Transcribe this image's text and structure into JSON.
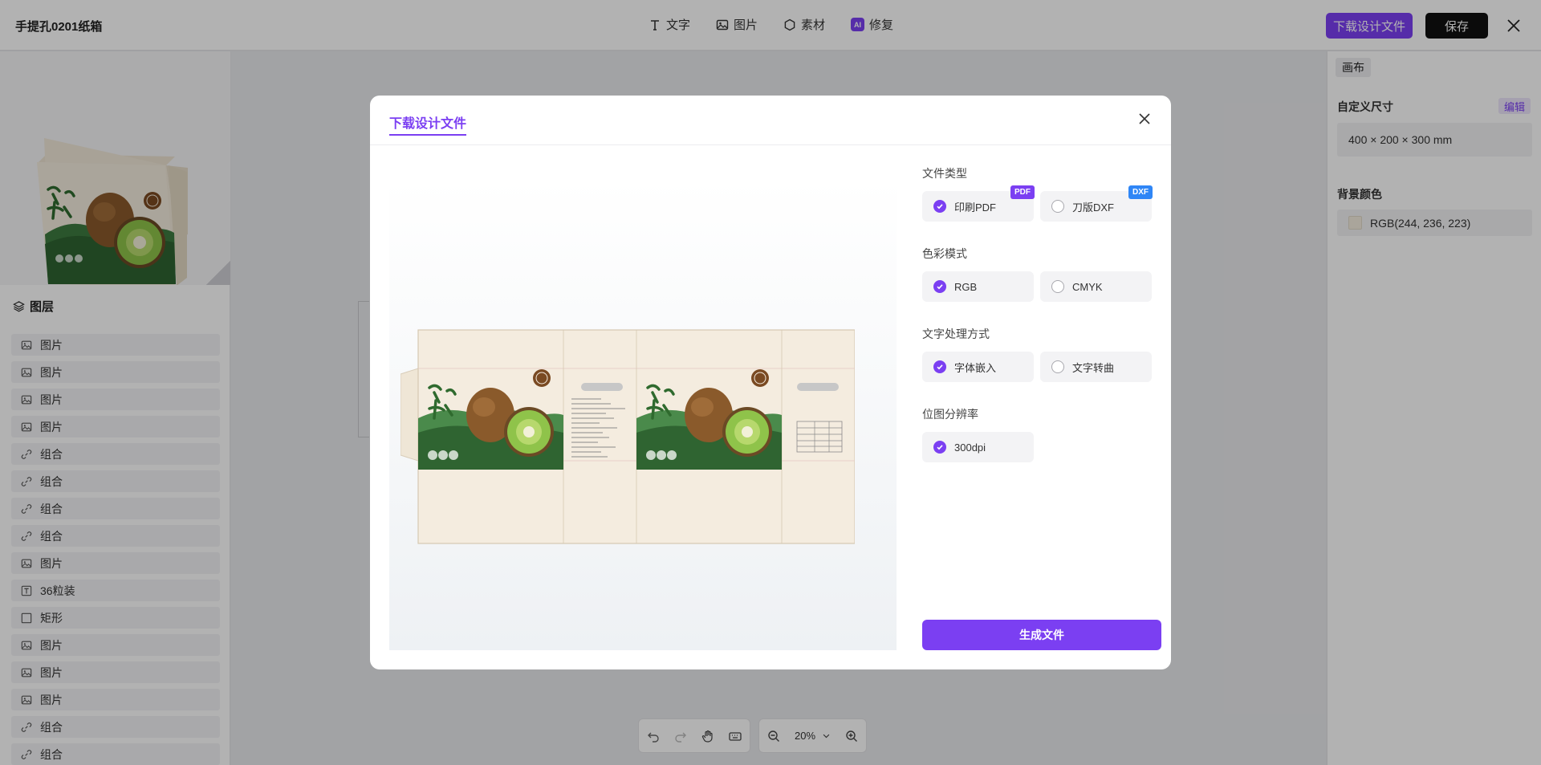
{
  "app": {
    "doc_title": "手提孔0201纸箱",
    "download_label": "下载设计文件",
    "save_label": "保存"
  },
  "toolbar": {
    "items": [
      {
        "label": "文字",
        "icon": "text-icon"
      },
      {
        "label": "图片",
        "icon": "image-icon"
      },
      {
        "label": "素材",
        "icon": "hexagon-icon"
      },
      {
        "label": "修复",
        "icon": "ai-icon",
        "badge": "AI"
      }
    ]
  },
  "layers": {
    "title": "图层",
    "items": [
      {
        "label": "图片",
        "type": "image"
      },
      {
        "label": "图片",
        "type": "image"
      },
      {
        "label": "图片",
        "type": "image"
      },
      {
        "label": "图片",
        "type": "image"
      },
      {
        "label": "组合",
        "type": "group"
      },
      {
        "label": "组合",
        "type": "group"
      },
      {
        "label": "组合",
        "type": "group"
      },
      {
        "label": "组合",
        "type": "group"
      },
      {
        "label": "图片",
        "type": "image"
      },
      {
        "label": "36粒装",
        "type": "text"
      },
      {
        "label": "矩形",
        "type": "rect"
      },
      {
        "label": "图片",
        "type": "image"
      },
      {
        "label": "图片",
        "type": "image"
      },
      {
        "label": "图片",
        "type": "image"
      },
      {
        "label": "组合",
        "type": "group"
      },
      {
        "label": "组合",
        "type": "group"
      }
    ]
  },
  "right_panel": {
    "tab": "画布",
    "size_label": "自定义尺寸",
    "edit_label": "编辑",
    "size_value": "400 × 200 × 300 mm",
    "bg_label": "背景颜色",
    "bg_value": "RGB(244, 236, 223)",
    "bg_color": "#f4ecdf"
  },
  "bottom_bar": {
    "zoom": "20%"
  },
  "modal": {
    "title": "下载设计文件",
    "groups": [
      {
        "label": "文件类型",
        "options": [
          {
            "label": "印刷PDF",
            "selected": true,
            "badge": "PDF",
            "badge_color": "#7b3ff2"
          },
          {
            "label": "刀版DXF",
            "selected": false,
            "badge": "DXF",
            "badge_color": "#2f86f6"
          }
        ]
      },
      {
        "label": "色彩模式",
        "options": [
          {
            "label": "RGB",
            "selected": true
          },
          {
            "label": "CMYK",
            "selected": false
          }
        ]
      },
      {
        "label": "文字处理方式",
        "options": [
          {
            "label": "字体嵌入",
            "selected": true
          },
          {
            "label": "文字转曲",
            "selected": false
          }
        ]
      },
      {
        "label": "位图分辨率",
        "options": [
          {
            "label": "300dpi",
            "selected": true
          }
        ]
      }
    ],
    "generate_label": "生成文件"
  },
  "colors": {
    "accent": "#7b3ff2",
    "kiwi_green": "#3d7a3f",
    "box_cream": "#f4ecdf"
  }
}
